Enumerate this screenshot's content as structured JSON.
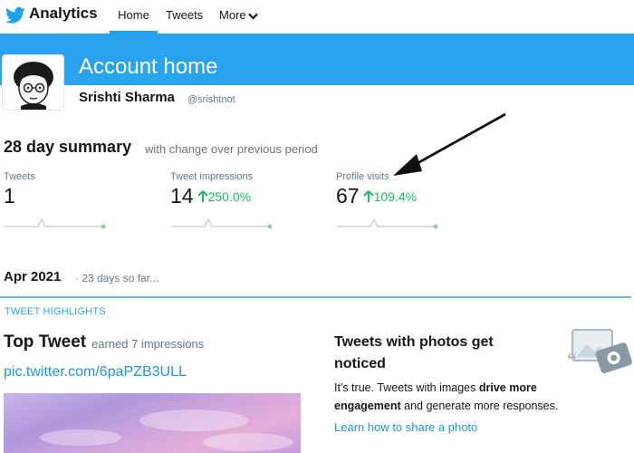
{
  "nav": {
    "brand": "Analytics",
    "home": "Home",
    "tweets": "Tweets",
    "more": "More"
  },
  "header": {
    "title": "Account home",
    "user_name": "Srishti Sharma",
    "user_handle": "@srishtnot"
  },
  "summary": {
    "title": "28 day summary",
    "subtitle": "with change over previous period",
    "stats": [
      {
        "label": "Tweets",
        "value": "1",
        "change": ""
      },
      {
        "label": "Tweet impressions",
        "value": "14",
        "change": "250.0%"
      },
      {
        "label": "Profile visits",
        "value": "67",
        "change": "109.4%"
      }
    ]
  },
  "month": {
    "title": "Apr 2021",
    "subtitle": "· 23 days so far..."
  },
  "highlights": {
    "label": "TWEET HIGHLIGHTS",
    "top_tweet_title": "Top Tweet",
    "top_tweet_sub": "earned 7 impressions",
    "tweet_link": "pic.twitter.com/6paPZB3ULL"
  },
  "promo": {
    "title": "Tweets with photos get noticed",
    "body_1": "It's true. Tweets with images ",
    "body_bold_1": "drive more engagement",
    "body_2": " and generate more responses.",
    "link": "Learn how to share a photo"
  },
  "colors": {
    "brand_blue": "#1da1f2",
    "header_blue": "#2aa3ef",
    "positive_green": "#17bf63",
    "link_blue": "#1b95e0"
  }
}
